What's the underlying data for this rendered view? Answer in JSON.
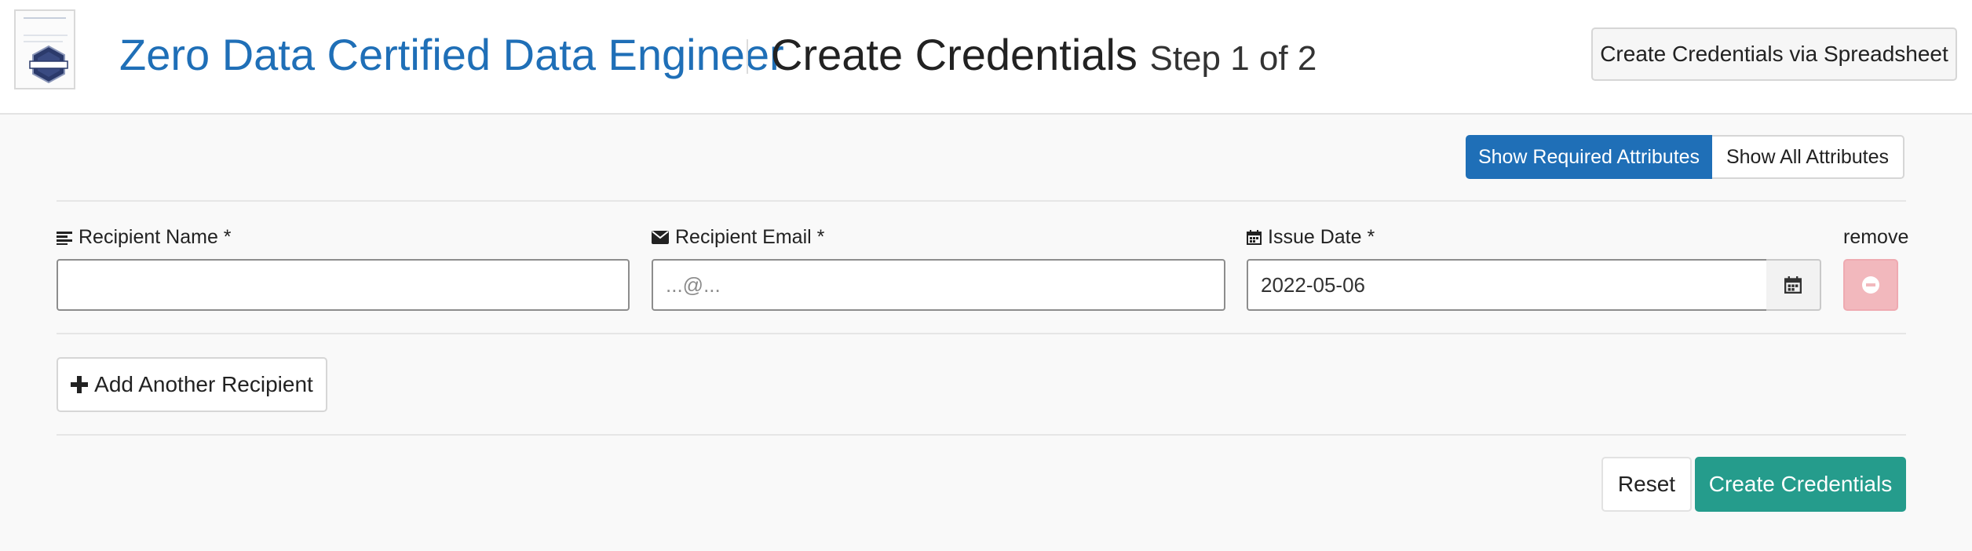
{
  "header": {
    "course_title": "Zero Data Certified Data Engineer",
    "page_title": "Create Credentials",
    "step": "Step 1 of 2",
    "spreadsheet_button": "Create Credentials via Spreadsheet"
  },
  "attribute_toggle": {
    "required_label": "Show Required Attributes",
    "all_label": "Show All Attributes",
    "active": "required"
  },
  "form": {
    "recipient_name": {
      "label": "Recipient Name *",
      "icon": "align-left-icon",
      "value": ""
    },
    "recipient_email": {
      "label": "Recipient Email *",
      "icon": "envelope-icon",
      "value": "",
      "placeholder": "...@..."
    },
    "issue_date": {
      "label": "Issue Date *",
      "icon": "calendar-icon",
      "value": "2022-05-06"
    },
    "remove_label": "remove"
  },
  "actions": {
    "add_recipient": "Add Another Recipient",
    "reset": "Reset",
    "create": "Create Credentials"
  },
  "colors": {
    "primary": "#1f6fb7",
    "success": "#259c8c",
    "danger_light": "#f2b8bd"
  }
}
